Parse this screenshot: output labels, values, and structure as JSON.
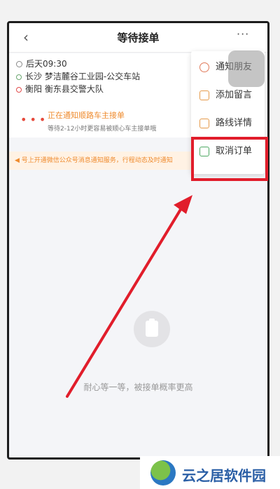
{
  "nav": {
    "title": "等待接单",
    "back_icon": "‹",
    "more_icon": "···"
  },
  "trip": {
    "time": "后天09:30",
    "from": "长沙 梦洁麓谷工业园-公交车站",
    "to": "衡阳 衡东县交警大队"
  },
  "notify": {
    "main": "正在通知顺路车主接单",
    "sub": "等待2-12小时更容易被顺心车主接单哦"
  },
  "banner": {
    "text": "号上开通微信公众号消息通知服务，行程动态及时通知"
  },
  "menu": {
    "items": [
      {
        "label": "通知朋友"
      },
      {
        "label": "添加留言"
      },
      {
        "label": "路线详情"
      },
      {
        "label": "取消订单"
      }
    ]
  },
  "empty": {
    "text": "耐心等一等，被接单概率更高"
  },
  "watermark": {
    "text": "云之居软件园"
  },
  "colors": {
    "accent": "#ef8b2e",
    "highlight": "#e11d2b",
    "arrow": "#e11d2b"
  }
}
